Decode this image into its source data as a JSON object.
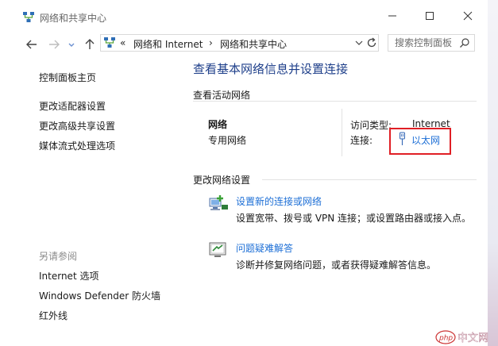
{
  "window": {
    "title": "网络和共享中心"
  },
  "nav": {
    "breadcrumb_prefix": "«",
    "breadcrumb": [
      "网络和 Internet",
      "网络和共享中心"
    ],
    "separator": "›",
    "search_placeholder": "搜索控制面板"
  },
  "sidebar": {
    "home": "控制面板主页",
    "links": [
      "更改适配器设置",
      "更改高级共享设置",
      "媒体流式处理选项"
    ],
    "see_also_header": "另请参阅",
    "see_also": [
      "Internet 选项",
      "Windows Defender 防火墙",
      "红外线"
    ]
  },
  "main": {
    "title": "查看基本网络信息并设置连接",
    "active_networks_header": "查看活动网络",
    "network": {
      "name": "网络",
      "type": "专用网络",
      "access_type_label": "访问类型:",
      "access_type_value": "Internet",
      "connections_label": "连接:",
      "connection_link": "以太网"
    },
    "change_settings_header": "更改网络设置",
    "tasks": [
      {
        "link": "设置新的连接或网络",
        "desc": "设置宽带、拨号或 VPN 连接；或设置路由器或接入点。"
      },
      {
        "link": "问题疑难解答",
        "desc": "诊断并修复网络问题，或者获得疑难解答信息。"
      }
    ]
  },
  "watermark": {
    "text": "php 中文网"
  },
  "colors": {
    "accent": "#1d6fd6",
    "title": "#1e3f8a",
    "highlight": "#e01f25"
  }
}
